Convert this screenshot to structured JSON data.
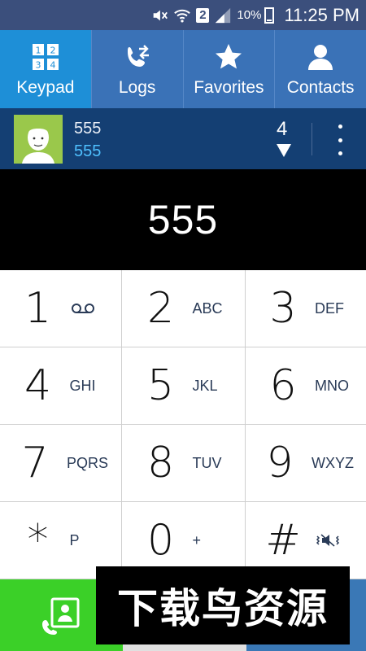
{
  "status_bar": {
    "badge": "2",
    "battery": "10%",
    "battery_level": 0.1,
    "time": "11:25 PM",
    "icons": [
      "mute-icon",
      "wifi-icon",
      "sim-badge",
      "signal-icon",
      "battery-icon"
    ]
  },
  "tabs": [
    {
      "label": "Keypad",
      "icon": "keypad-icon",
      "active": true
    },
    {
      "label": "Logs",
      "icon": "call-logs-icon",
      "active": false
    },
    {
      "label": "Favorites",
      "icon": "star-icon",
      "active": false
    },
    {
      "label": "Contacts",
      "icon": "contacts-icon",
      "active": false
    }
  ],
  "suggestion": {
    "name": "555",
    "number": "555",
    "count": "4"
  },
  "display": {
    "number": "555"
  },
  "keys": [
    {
      "digit": "1",
      "letters": "",
      "icon": "voicemail-icon"
    },
    {
      "digit": "2",
      "letters": "ABC"
    },
    {
      "digit": "3",
      "letters": "DEF"
    },
    {
      "digit": "4",
      "letters": "GHI"
    },
    {
      "digit": "5",
      "letters": "JKL"
    },
    {
      "digit": "6",
      "letters": "MNO"
    },
    {
      "digit": "7",
      "letters": "PQRS"
    },
    {
      "digit": "8",
      "letters": "TUV"
    },
    {
      "digit": "9",
      "letters": "WXYZ"
    },
    {
      "digit": "*",
      "letters": "P"
    },
    {
      "digit": "0",
      "letters": "+"
    },
    {
      "digit": "#",
      "letters": "",
      "icon": "vibrate-mute-icon"
    }
  ],
  "watermark": "下载鸟资源",
  "colors": {
    "status_bar": "#3b4f7c",
    "tab_bar": "#3a72b7",
    "tab_active": "#1e8fd7",
    "suggestion_bg": "#143f73",
    "suggestion_number": "#4fc0ff",
    "call_button": "#3bd028"
  }
}
